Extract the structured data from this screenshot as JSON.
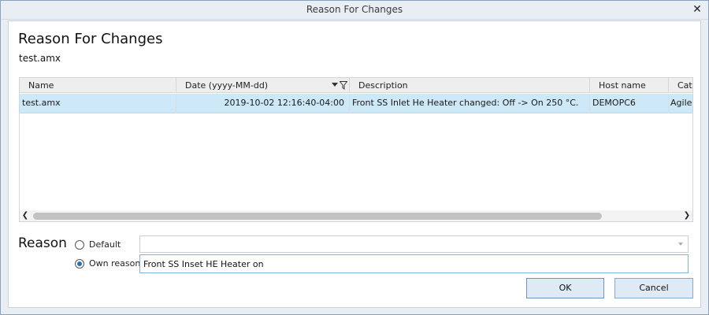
{
  "window": {
    "title": "Reason For Changes",
    "close_glyph": "✕"
  },
  "dialog": {
    "heading": "Reason For Changes",
    "filename": "test.amx"
  },
  "grid": {
    "columns": [
      "Name",
      "Date (yyyy-MM-dd)",
      "Description",
      "Host name",
      "Cate"
    ],
    "rows": [
      {
        "name": "test.amx",
        "date": "2019-10-02 12:16:40-04:00",
        "description": "Front SS Inlet He Heater changed: Off -> On 250 °C.",
        "host": "DEMOPC6",
        "category": "Agile"
      }
    ],
    "scroll_left_glyph": "❮",
    "scroll_right_glyph": "❯"
  },
  "reason": {
    "label": "Reason",
    "default_label": "Default",
    "own_label": "Own reason",
    "selected": "own",
    "default_value": "",
    "own_value": "Front SS Inset HE Heater on"
  },
  "buttons": {
    "ok": "OK",
    "cancel": "Cancel"
  },
  "colors": {
    "selected_row": "#cde8f6",
    "accent": "#2a6fb5"
  }
}
